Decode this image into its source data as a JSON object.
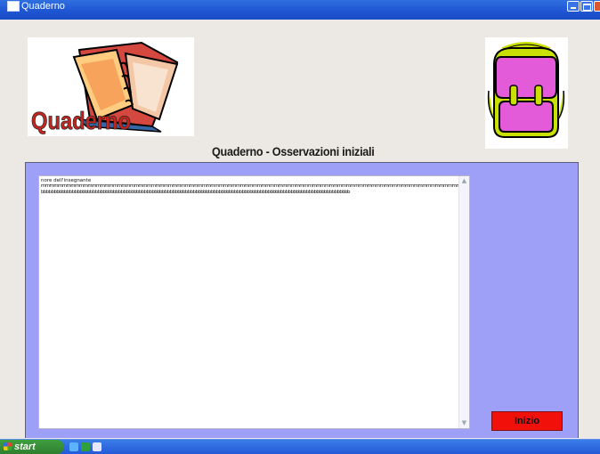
{
  "window": {
    "title": "Quaderno"
  },
  "logo_book": {
    "caption": "Quaderno",
    "icon": "notebook-clipart-icon"
  },
  "logo_backpack": {
    "icon": "school-backpack-clipart-icon"
  },
  "heading": "Quaderno - Osservazioni iniziali",
  "textarea": {
    "line1": "nore dell'insegnante",
    "line2": "mmmmmmmmmmmmmmmmmmmmmmmmmmmmmmmmmmmmmmmmmmmmmmmmmmmmmmmmmmmmmmmmmmmmmmmmmmmmmmmmmmmmmmmmmmmmmmmmmmmmmmmmmmmmmmmmmmmm",
    "line3": "bbbbbbbbbbbbbbbbbbbbbbbbbbbbbbbbbbbbbbbbbbbbbbbbbbbbbbbbbbbbbbbbbbbbbbbbbbbbbbbbbbbbbbbbbbbbbbbbbbbbbbbbbbbbbbbbbbbbbbbb"
  },
  "buttons": {
    "inizio": "Inizio"
  },
  "taskbar": {
    "start_label": "start"
  },
  "colors": {
    "panel_bg": "#9e9ff6",
    "button_bg": "#f2100b",
    "titlebar": "#1f56d3"
  }
}
